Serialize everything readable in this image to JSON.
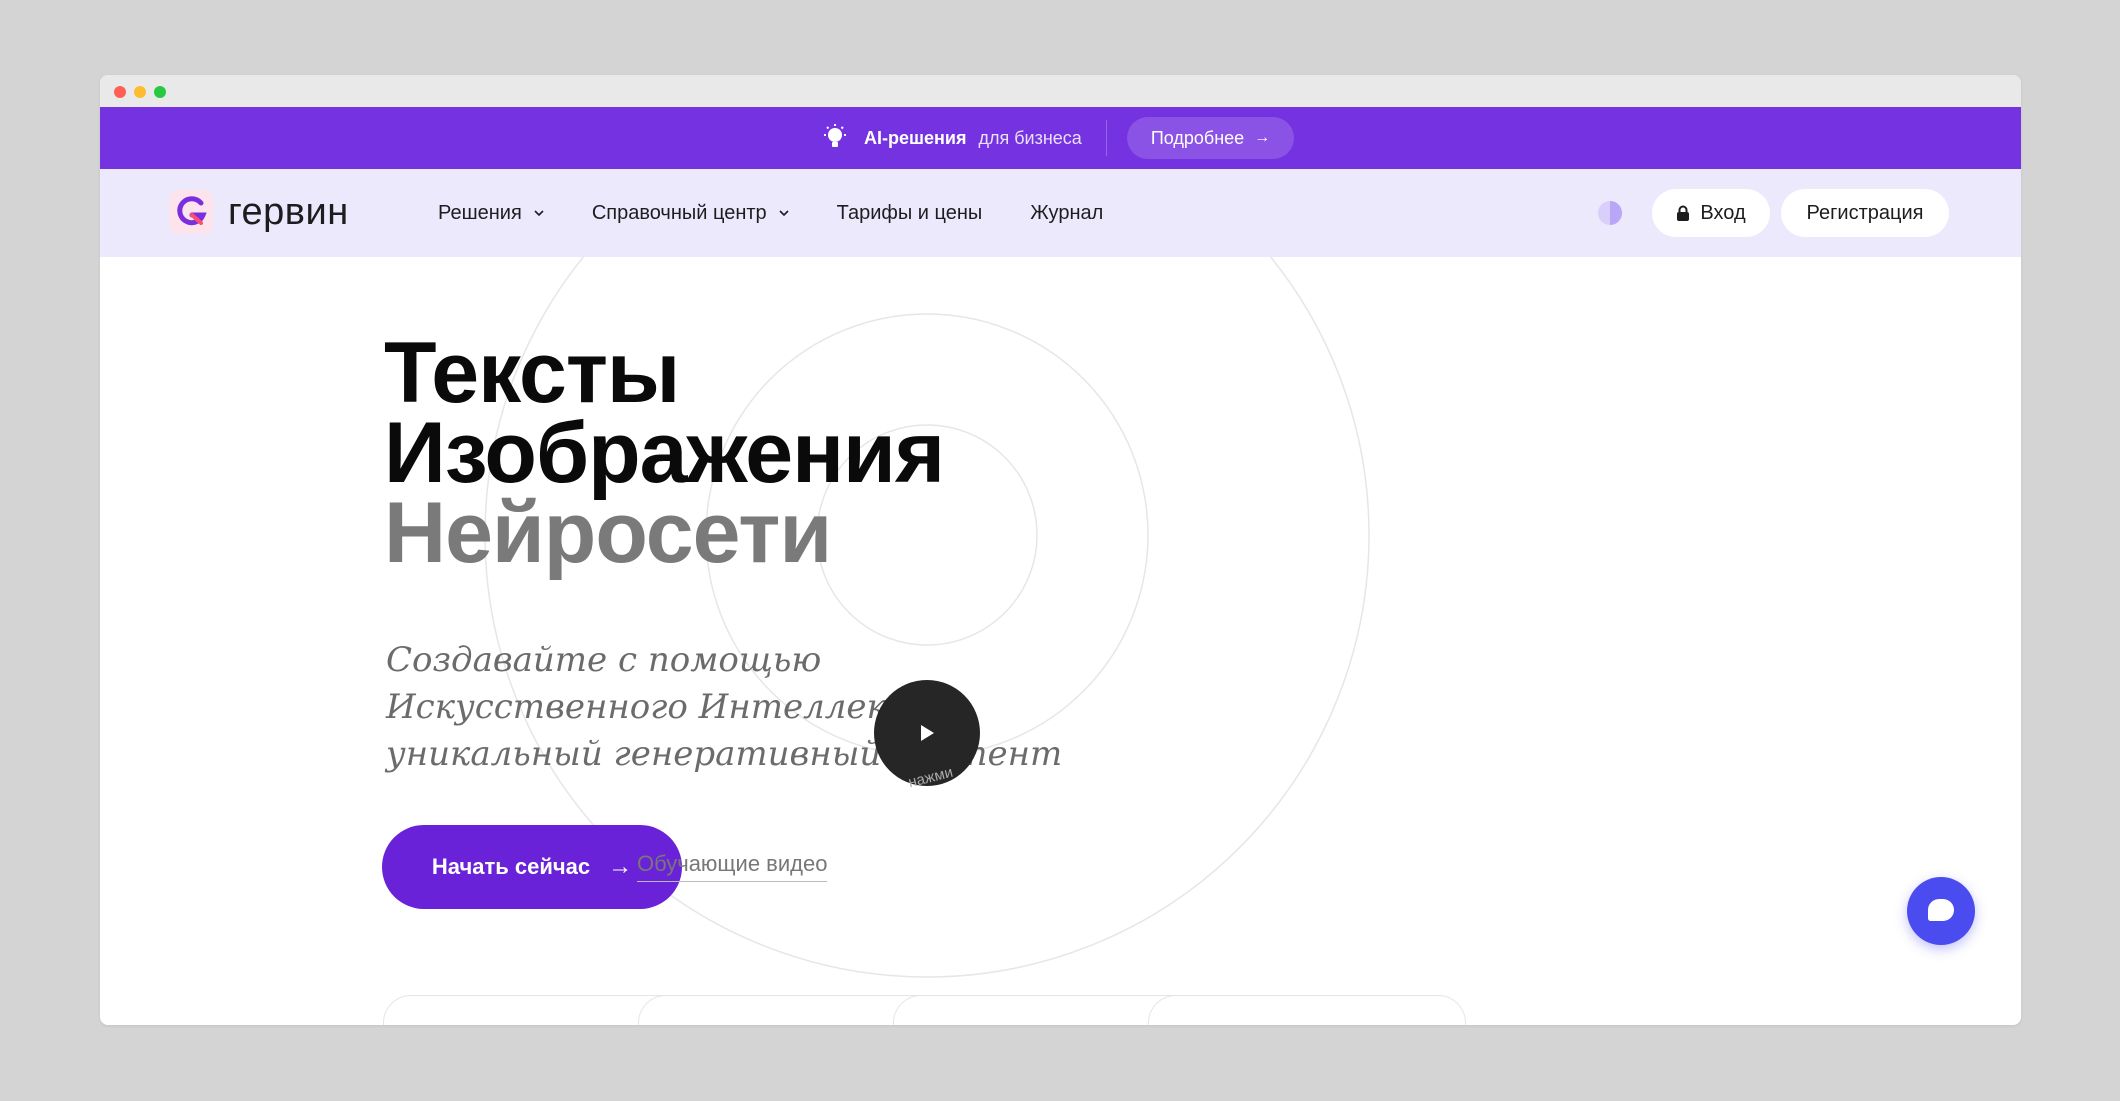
{
  "promo": {
    "title": "AI-решения",
    "subtitle": "для бизнеса",
    "button_label": "Подробнее",
    "button_arrow": "→",
    "icon": "lightbulb-icon"
  },
  "header": {
    "logo_text": "гервин",
    "nav": [
      {
        "label": "Решения",
        "has_dropdown": true
      },
      {
        "label": "Справочный центр",
        "has_dropdown": true
      },
      {
        "label": "Тарифы и цены",
        "has_dropdown": false
      },
      {
        "label": "Журнал",
        "has_dropdown": false
      }
    ],
    "login_label": "Вход",
    "register_label": "Регистрация"
  },
  "hero": {
    "line1": "Тексты",
    "line2": "Изображения",
    "line3": "Нейросети",
    "subtitle": "Создавайте с помощью Искусственного Интеллекта уникальный генеративный контент",
    "cta_label": "Начать сейчас",
    "cta_arrow": "→",
    "video_link": "Обучающие видео",
    "play_hint": "нажми"
  },
  "colors": {
    "promo_bg": "#7432e0",
    "nav_bg": "#ede9fd",
    "cta_bg": "#6a22d8",
    "chat_bg": "#4a4cf0"
  }
}
